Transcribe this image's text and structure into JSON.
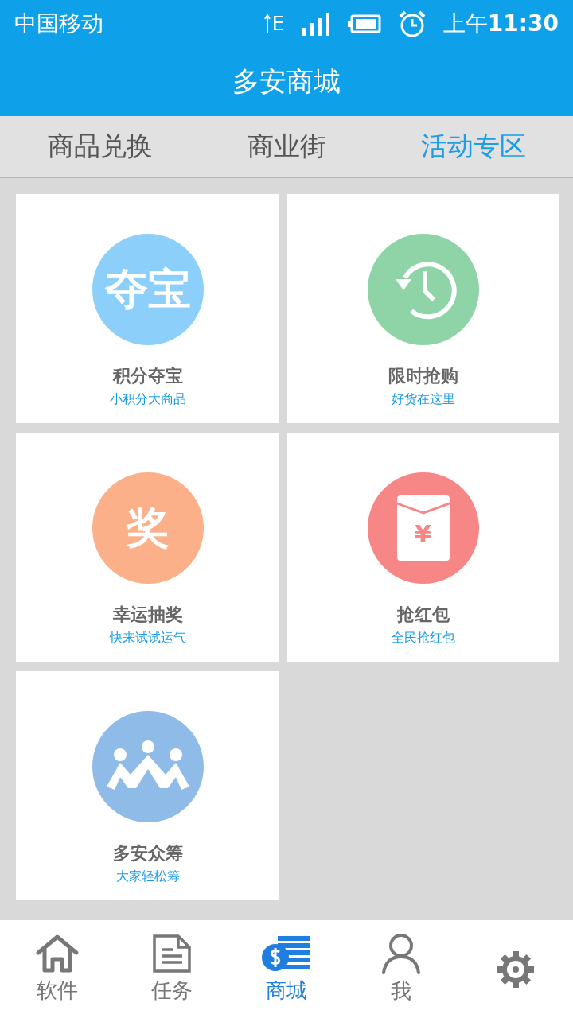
{
  "status_bar": {
    "carrier": "中国移动",
    "network": "E",
    "time_prefix": "上午",
    "time": "11:30"
  },
  "title": "多安商城",
  "tabs": [
    {
      "label": "商品兑换",
      "selected": false
    },
    {
      "label": "商业街",
      "selected": false
    },
    {
      "label": "活动专区",
      "selected": true
    }
  ],
  "cards": [
    {
      "title": "积分夺宝",
      "subtitle": "小积分大商品",
      "kind": "logo",
      "logo_text": "夺宝",
      "color": "#8ccffb"
    },
    {
      "title": "限时抢购",
      "subtitle": "好货在这里",
      "kind": "clock",
      "color": "#8fd4a6"
    },
    {
      "title": "幸运抽奖",
      "subtitle": "快来试试运气",
      "kind": "logo",
      "logo_text": "奖",
      "color": "#fbb08a"
    },
    {
      "title": "抢红包",
      "subtitle": "全民抢红包",
      "kind": "envelope",
      "logo_text": "¥",
      "color": "#f78686"
    },
    {
      "title": "多安众筹",
      "subtitle": "大家轻松筹",
      "kind": "people",
      "color": "#8fbbe8"
    }
  ],
  "nav": [
    {
      "label": "软件",
      "kind": "home",
      "selected": false
    },
    {
      "label": "任务",
      "kind": "document",
      "selected": false
    },
    {
      "label": "商城",
      "kind": "coins",
      "selected": true
    },
    {
      "label": "我",
      "kind": "person",
      "selected": false
    },
    {
      "kind": "gear",
      "selected": false
    }
  ]
}
